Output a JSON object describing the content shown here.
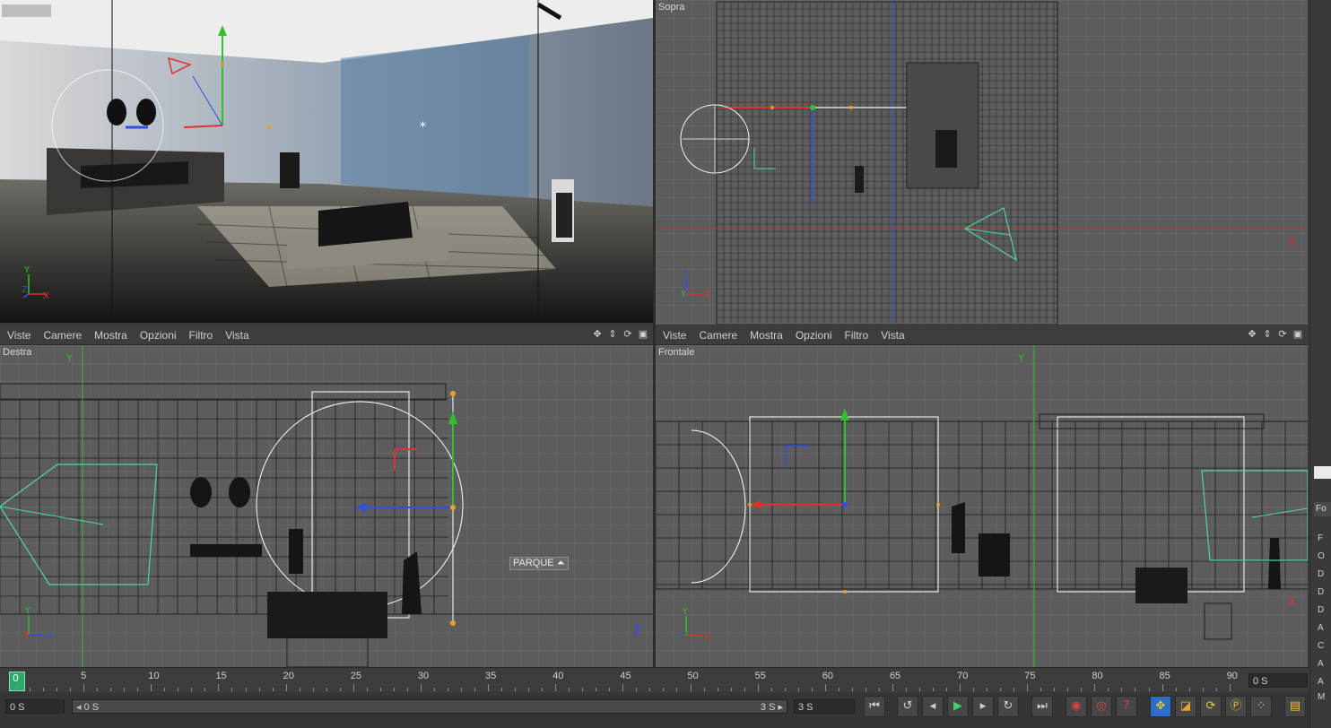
{
  "viewports": {
    "perspective": {
      "label": ""
    },
    "top": {
      "label": "Sopra",
      "axis_x": "X"
    },
    "right": {
      "label": "Destra",
      "axis_y": "Y",
      "object_tag": "PARQUE"
    },
    "front": {
      "label": "Frontale",
      "axis_y": "Y",
      "axis_x": "X"
    }
  },
  "menu": {
    "items": [
      "Viste",
      "Camere",
      "Mostra",
      "Opzioni",
      "Filtro",
      "Vista"
    ]
  },
  "icons": {
    "viewport_tools": [
      "move-icon",
      "zoom-icon",
      "rotate-icon",
      "maximize-icon"
    ],
    "playback": [
      "first-frame-icon",
      "prev-key-icon",
      "prev-frame-icon",
      "play-icon",
      "next-frame-icon",
      "next-key-icon",
      "loop-icon",
      "last-frame-icon"
    ],
    "record": [
      "record-icon",
      "autokey-icon",
      "help-icon"
    ],
    "tools": [
      "move-tool-icon",
      "scale-tool-icon",
      "rotate-tool-icon",
      "param-icon",
      "grid-icon",
      "film-icon"
    ]
  },
  "timeline": {
    "current_frame": "0",
    "ticks": [
      "5",
      "10",
      "15",
      "20",
      "25",
      "30",
      "35",
      "40",
      "45",
      "50",
      "55",
      "60",
      "65",
      "70",
      "75",
      "80",
      "85",
      "90"
    ],
    "end_field": "0 S"
  },
  "bottombar": {
    "current_time": "0 S",
    "range_start": "0 S",
    "range_end_inner": "3 S",
    "range_end": "3 S"
  },
  "rightstrip": {
    "tab_label": "Fo",
    "items": [
      "F",
      "O",
      "D",
      "D",
      "D",
      "A",
      "C",
      "A",
      "A",
      "M"
    ]
  },
  "colors": {
    "viewport_bg": "#5c5c5c",
    "axis_x": "#e03030",
    "axis_y": "#30c030",
    "axis_z": "#3050e0",
    "camera": "#4fd6a0"
  }
}
